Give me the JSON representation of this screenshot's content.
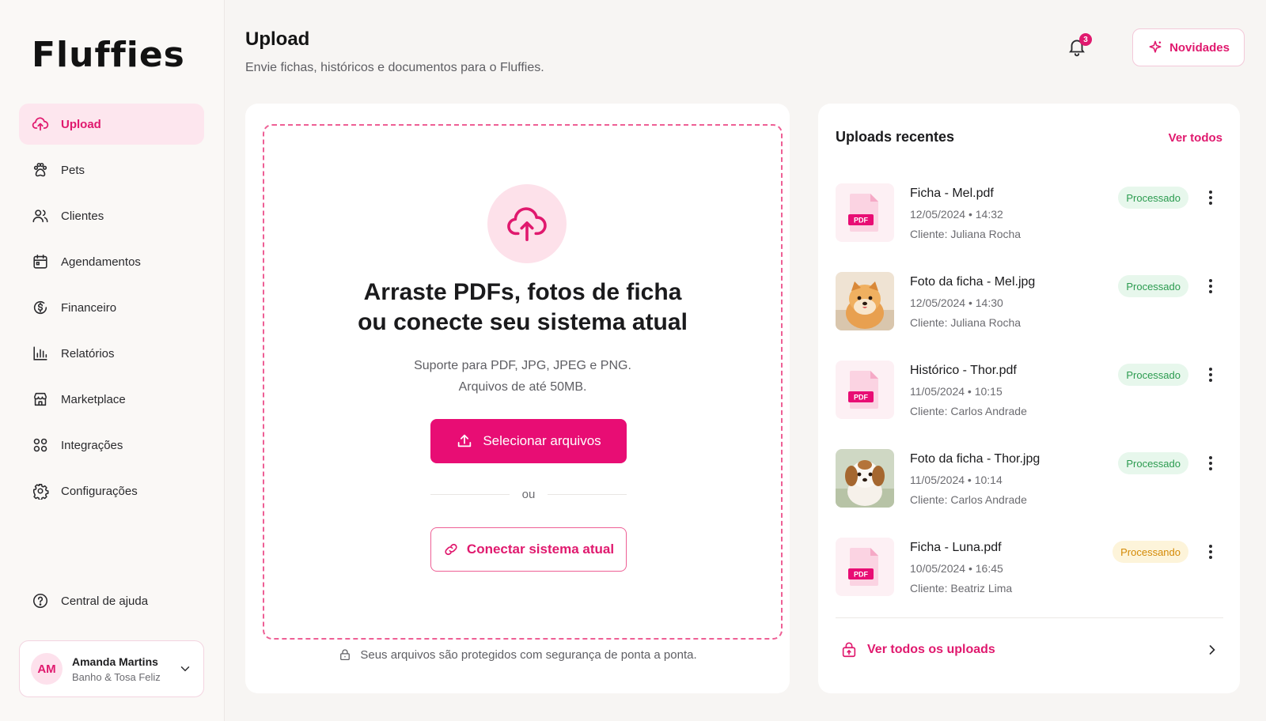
{
  "app": {
    "brand": "Fluffies"
  },
  "colors": {
    "accent": "#e80d74",
    "success": "#2b9b4f",
    "warning": "#d48a06"
  },
  "sidebar": {
    "items": [
      {
        "label": "Upload",
        "icon": "cloud-upload-icon",
        "active": true
      },
      {
        "label": "Pets",
        "icon": "paw-icon"
      },
      {
        "label": "Clientes",
        "icon": "users-icon"
      },
      {
        "label": "Agendamentos",
        "icon": "calendar-icon"
      },
      {
        "label": "Financeiro",
        "icon": "dollar-icon"
      },
      {
        "label": "Relatórios",
        "icon": "bar-chart-icon"
      },
      {
        "label": "Marketplace",
        "icon": "store-icon"
      },
      {
        "label": "Integrações",
        "icon": "integrations-icon"
      },
      {
        "label": "Configurações",
        "icon": "gear-icon"
      }
    ],
    "help_label": "Central de ajuda",
    "user": {
      "initials": "AM",
      "name": "Amanda Martins",
      "shop": "Banho & Tosa Feliz"
    }
  },
  "header": {
    "title": "Upload",
    "subtitle": "Envie fichas, históricos e documentos para o Fluffies.",
    "notification_count": "3",
    "news_label": "Novidades"
  },
  "upload": {
    "title_line1": "Arraste PDFs, fotos de ficha",
    "title_line2": "ou conecte seu sistema atual",
    "support_line1": "Suporte para PDF, JPG, JPEG e PNG.",
    "support_line2": "Arquivos de até 50MB.",
    "select_label": "Selecionar arquivos",
    "or_label": "ou",
    "connect_label": "Conectar sistema atual",
    "security_note": "Seus arquivos são protegidos com segurança de ponta a ponta."
  },
  "recent": {
    "title": "Uploads recentes",
    "see_all": "Ver todos",
    "footer_label": "Ver todos os uploads",
    "pdf_badge": "PDF",
    "items": [
      {
        "name": "Ficha - Mel.pdf",
        "date": "12/05/2024 • 14:32",
        "client": "Cliente: Juliana Rocha",
        "status": "Processado"
      },
      {
        "name": "Foto da ficha - Mel.jpg",
        "date": "12/05/2024 • 14:30",
        "client": "Cliente: Juliana Rocha",
        "status": "Processado"
      },
      {
        "name": "Histórico - Thor.pdf",
        "date": "11/05/2024 • 10:15",
        "client": "Cliente: Carlos Andrade",
        "status": "Processado"
      },
      {
        "name": "Foto da ficha - Thor.jpg",
        "date": "11/05/2024 • 10:14",
        "client": "Cliente: Carlos Andrade",
        "status": "Processado"
      },
      {
        "name": "Ficha - Luna.pdf",
        "date": "10/05/2024 • 16:45",
        "client": "Cliente: Beatriz Lima",
        "status": "Processando"
      }
    ]
  }
}
